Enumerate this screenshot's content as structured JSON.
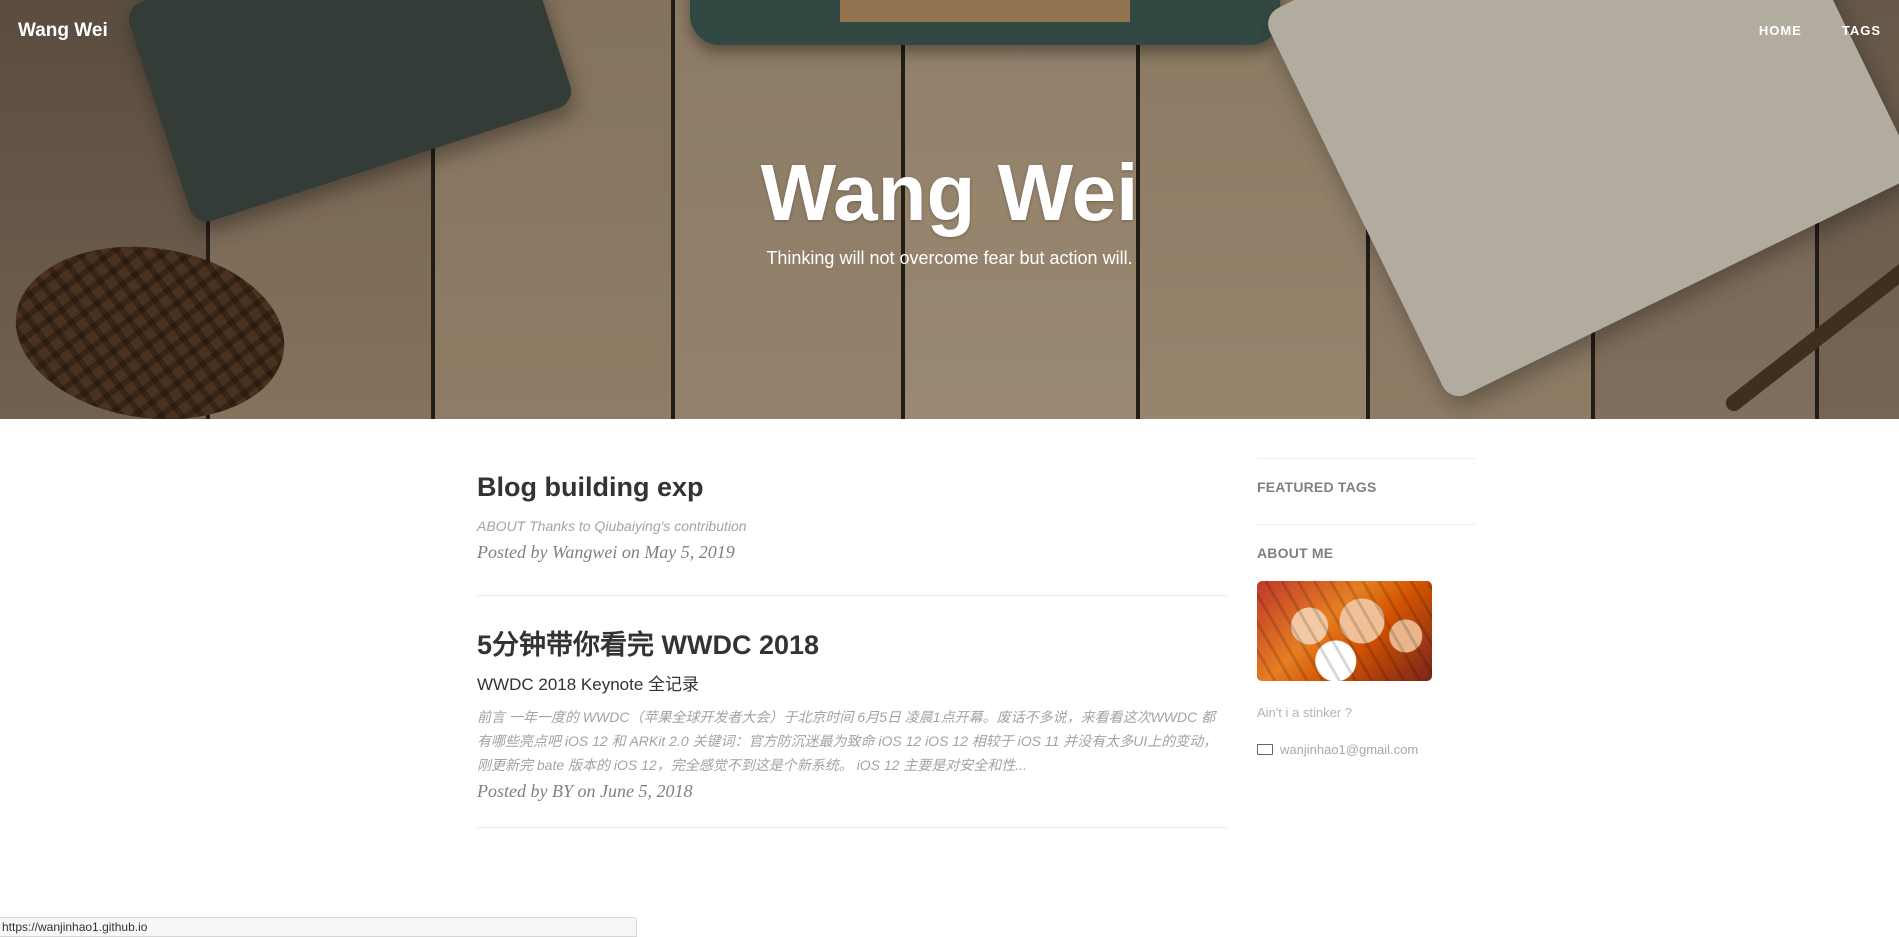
{
  "nav": {
    "brand": "Wang Wei",
    "links": [
      "HOME",
      "TAGS"
    ]
  },
  "hero": {
    "title": "Wang Wei",
    "subtitle": "Thinking will not overcome fear but action will."
  },
  "posts": [
    {
      "title": "Blog building exp",
      "subtitle": "",
      "excerpt": "ABOUT Thanks to Qiubaiying's contribution",
      "meta": "Posted by Wangwei on May 5, 2019"
    },
    {
      "title": "5分钟带你看完 WWDC 2018",
      "subtitle": "WWDC 2018 Keynote 全记录",
      "excerpt": "前言 一年一度的 WWDC（苹果全球开发者大会）于北京时间 6月5日 凌晨1点开幕。废话不多说，来看看这次WWDC 都有哪些亮点吧 iOS 12 和 ARKit 2.0 关键词：官方防沉迷最为致命 iOS 12 iOS 12 相较于 iOS 11 并没有太多UI上的变动，刚更新完 bate 版本的 iOS 12，完全感觉不到这是个新系统。 iOS 12 主要是对安全和性...",
      "meta": "Posted by BY on June 5, 2018"
    }
  ],
  "sidebar": {
    "featured_tags_heading": "FEATURED TAGS",
    "about_heading": "ABOUT ME",
    "about_text": "Ain't i a stinker ?",
    "email": "wanjinhao1@gmail.com"
  },
  "statusbar": {
    "url": "https://wanjinhao1.github.io"
  }
}
